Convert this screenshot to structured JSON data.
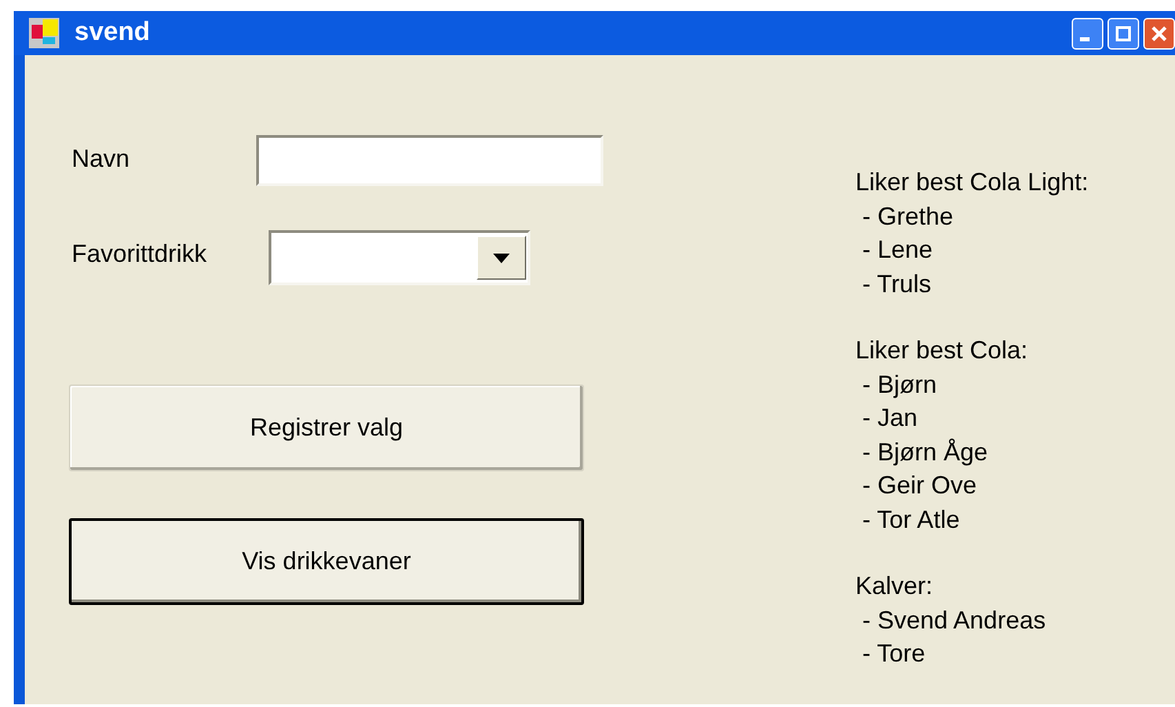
{
  "window": {
    "title": "svend"
  },
  "fields": [
    {
      "label": "Navn",
      "kind": "text"
    },
    {
      "label": "Favorittdrikk",
      "kind": "combo"
    }
  ],
  "buttons": [
    {
      "label": "Registrer valg",
      "default": false
    },
    {
      "label": "Vis drikkevaner",
      "default": true
    }
  ],
  "groups": [
    {
      "heading": "Liker best Cola Light:",
      "members": [
        " - Grethe",
        " - Lene",
        " - Truls"
      ]
    },
    {
      "heading": "Liker best Cola:",
      "members": [
        " - Bjørn",
        " - Jan",
        " - Bjørn Åge",
        " - Geir Ove",
        " - Tor Atle"
      ]
    },
    {
      "heading": "Kalver:",
      "members": [
        " - Svend Andreas",
        " - Tore"
      ]
    }
  ]
}
